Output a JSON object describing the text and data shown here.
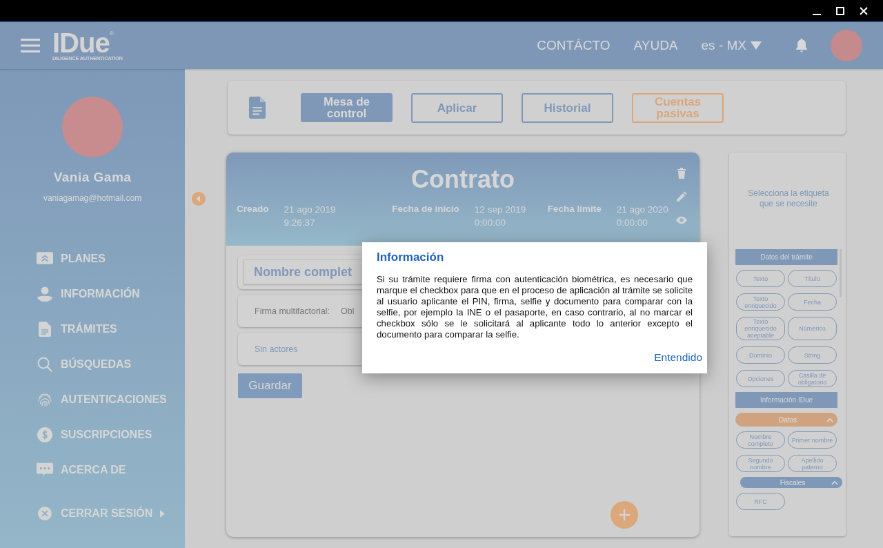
{
  "header": {
    "logo": "IDue",
    "logo_mark": "®",
    "logo_tagline": "DILIGENCE AUTHENTICATION",
    "links": [
      "CONTÁCTO",
      "AYUDA"
    ],
    "language": "es - MX"
  },
  "sidebar": {
    "user_name": "Vania Gama",
    "user_email": "vaniagamag@hotmail.com",
    "items": [
      {
        "label": "PLANES"
      },
      {
        "label": "INFORMACIÓN"
      },
      {
        "label": "TRÁMITES"
      },
      {
        "label": "BÚSQUEDAS"
      },
      {
        "label": "AUTENTICACIONES"
      },
      {
        "label": "SUSCRIPCIONES"
      },
      {
        "label": "ACERCA DE"
      }
    ],
    "logout": "CERRAR SESIÓN"
  },
  "toolbar": {
    "tabs": [
      {
        "label": "Mesa de control",
        "selected": true,
        "color": "#7f98b8"
      },
      {
        "label": "Aplicar",
        "selected": false,
        "color": "#7f98b8"
      },
      {
        "label": "Historial",
        "selected": false,
        "color": "#7f98b8"
      },
      {
        "label": "Cuentas pasivas",
        "selected": false,
        "color": "#dba67a"
      }
    ]
  },
  "contract": {
    "title": "Contrato",
    "dates": [
      {
        "label": "Creado",
        "value": "21 ago 2019\n9:26:37"
      },
      {
        "label": "Fecha de inicio",
        "value": "12 sep 2019\n0:00:00"
      },
      {
        "label": "Fecha límite",
        "value": "21 ago 2020\n0:00:00"
      }
    ],
    "field": "Nombre complet",
    "signature_label": "Firma multifactorial:",
    "signature_value": "Obl",
    "actors": "Sin actores",
    "save": "Guardar"
  },
  "tags_panel": {
    "prompt": "Selecciona la etiqueta que se necesite",
    "sections": [
      {
        "kind": "header",
        "label": "Datos del trámite"
      },
      {
        "kind": "chips",
        "chips": [
          "Texto",
          "Título",
          "Texto enriquecido",
          "Fecha",
          "Texto enriquecido aceptable",
          "Númerico",
          "Dominio",
          "String",
          "Opciones",
          "Casilla de obligatorio"
        ]
      },
      {
        "kind": "header",
        "label": "Información IDue"
      },
      {
        "kind": "group",
        "label": "Datos",
        "expanded": true,
        "color": "#cfa37f"
      },
      {
        "kind": "chips",
        "chips": [
          "Nombre completo",
          "Primer nombre",
          "Segundo nombre",
          "Apellido paterno"
        ]
      },
      {
        "kind": "subgroup",
        "label": "Fiscales",
        "expanded": true,
        "color": "#7f98b8"
      },
      {
        "kind": "chips",
        "chips": [
          "RFC"
        ]
      }
    ]
  },
  "dialog": {
    "title": "Información",
    "body": "Si su trámite requiere firma con autenticación biométrica, es necesario que marque el checkbox para que en el proceso de aplicación al trámite se solicite al usuario aplicante el PIN, firma, selfie y documento para comparar con la selfie, por ejemplo la INE o el pasaporte, en caso contrario, al no marcar el checkbox sólo se le solicitará al aplicante todo lo anterior excepto el documento para comparar la selfie.",
    "action": "Entendido"
  }
}
